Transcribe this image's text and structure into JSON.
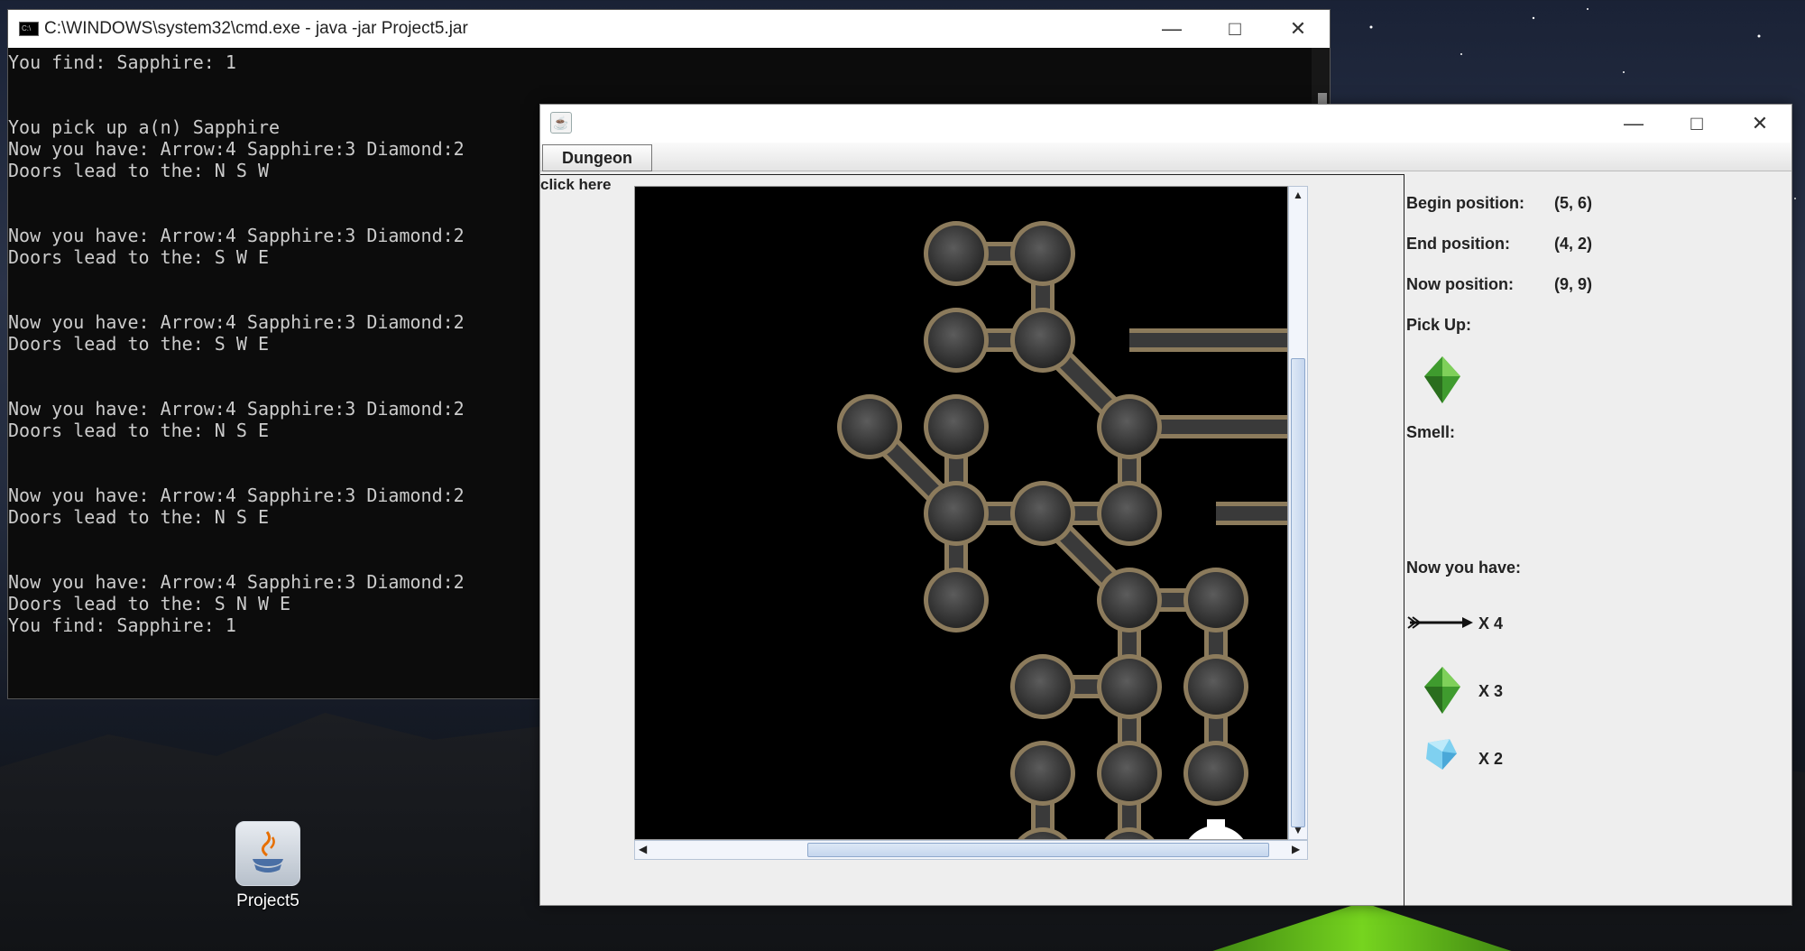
{
  "desktop": {
    "icon_label": "Project5"
  },
  "cmd": {
    "title": "C:\\WINDOWS\\system32\\cmd.exe - java  -jar Project5.jar",
    "lines": [
      "You find: Sapphire: 1",
      "",
      "",
      "You pick up a(n) Sapphire",
      "Now you have: Arrow:4 Sapphire:3 Diamond:2",
      "Doors lead to the: N S W",
      "",
      "",
      "Now you have: Arrow:4 Sapphire:3 Diamond:2",
      "Doors lead to the: S W E",
      "",
      "",
      "Now you have: Arrow:4 Sapphire:3 Diamond:2",
      "Doors lead to the: S W E",
      "",
      "",
      "Now you have: Arrow:4 Sapphire:3 Diamond:2",
      "Doors lead to the: N S E",
      "",
      "",
      "Now you have: Arrow:4 Sapphire:3 Diamond:2",
      "Doors lead to the: N S E",
      "",
      "",
      "Now you have: Arrow:4 Sapphire:3 Diamond:2",
      "Doors lead to the: S N W E",
      "You find: Sapphire: 1"
    ]
  },
  "jframe": {
    "menu_label": "Dungeon",
    "click_here": "click here",
    "panel": {
      "begin_label": "Begin position:",
      "begin_value": "(5, 6)",
      "end_label": "End position:",
      "end_value": "(4, 2)",
      "now_label": "Now position:",
      "now_value": "(9, 9)",
      "pickup_label": "Pick Up:",
      "pickup_item": "green-sapphire-icon",
      "smell_label": "Smell:",
      "have_label": "Now you have:",
      "inventory": [
        {
          "icon": "arrow-icon",
          "count": "X 4"
        },
        {
          "icon": "green-sapphire-icon",
          "count": "X 3"
        },
        {
          "icon": "blue-diamond-icon",
          "count": "X 2"
        }
      ]
    }
  },
  "colors": {
    "room": "#3c3c3c",
    "tunnel_edge": "#8c7b5c",
    "player": "#ffffff",
    "sapphire": "#3f9b2e",
    "diamond": "#7fd0f0"
  }
}
